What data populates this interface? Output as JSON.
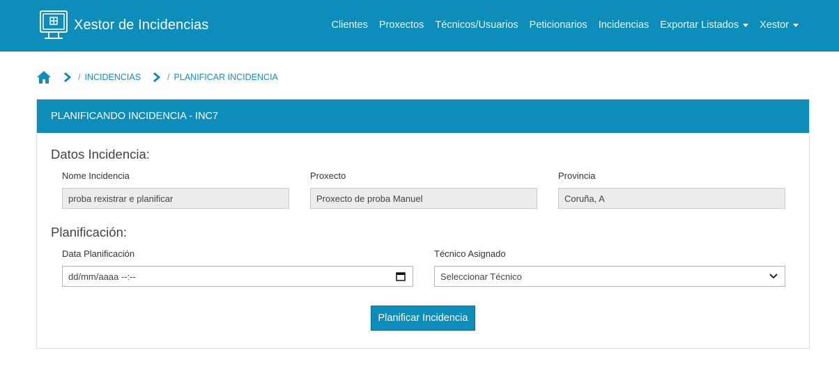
{
  "brand": {
    "title": "Xestor de Incidencias",
    "icon": "monitor-icon"
  },
  "nav": {
    "items": [
      {
        "label": "Clientes"
      },
      {
        "label": "Proxectos"
      },
      {
        "label": "Técnicos/Usuarios"
      },
      {
        "label": "Peticionarios"
      },
      {
        "label": "Incidencias"
      },
      {
        "label": "Exportar Listados",
        "dropdown": true
      },
      {
        "label": "Xestor",
        "dropdown": true
      }
    ]
  },
  "breadcrumb": {
    "sep": "/",
    "items": [
      {
        "label": "INCIDENCIAS"
      },
      {
        "label": "PLANIFICAR INCIDENCIA"
      }
    ]
  },
  "card": {
    "header": "PLANIFICANDO INCIDENCIA - INC7",
    "datos": {
      "title": "Datos Incidencia:",
      "nome_label": "Nome Incidencia",
      "nome_value": "proba rexistrar e planificar",
      "proxecto_label": "Proxecto",
      "proxecto_value": "Proxecto de proba Manuel",
      "provincia_label": "Provincia",
      "provincia_value": "Coruña, A"
    },
    "planificacion": {
      "title": "Planificación:",
      "data_label": "Data Planificación",
      "data_placeholder": "dd/mm/aaaa --:--",
      "tecnico_label": "Técnico Asignado",
      "tecnico_value": "Seleccionar Técnico"
    },
    "submit_label": "Planificar Incidencia"
  },
  "colors": {
    "primary": "#0d8dba",
    "link": "#1a8cb8"
  }
}
